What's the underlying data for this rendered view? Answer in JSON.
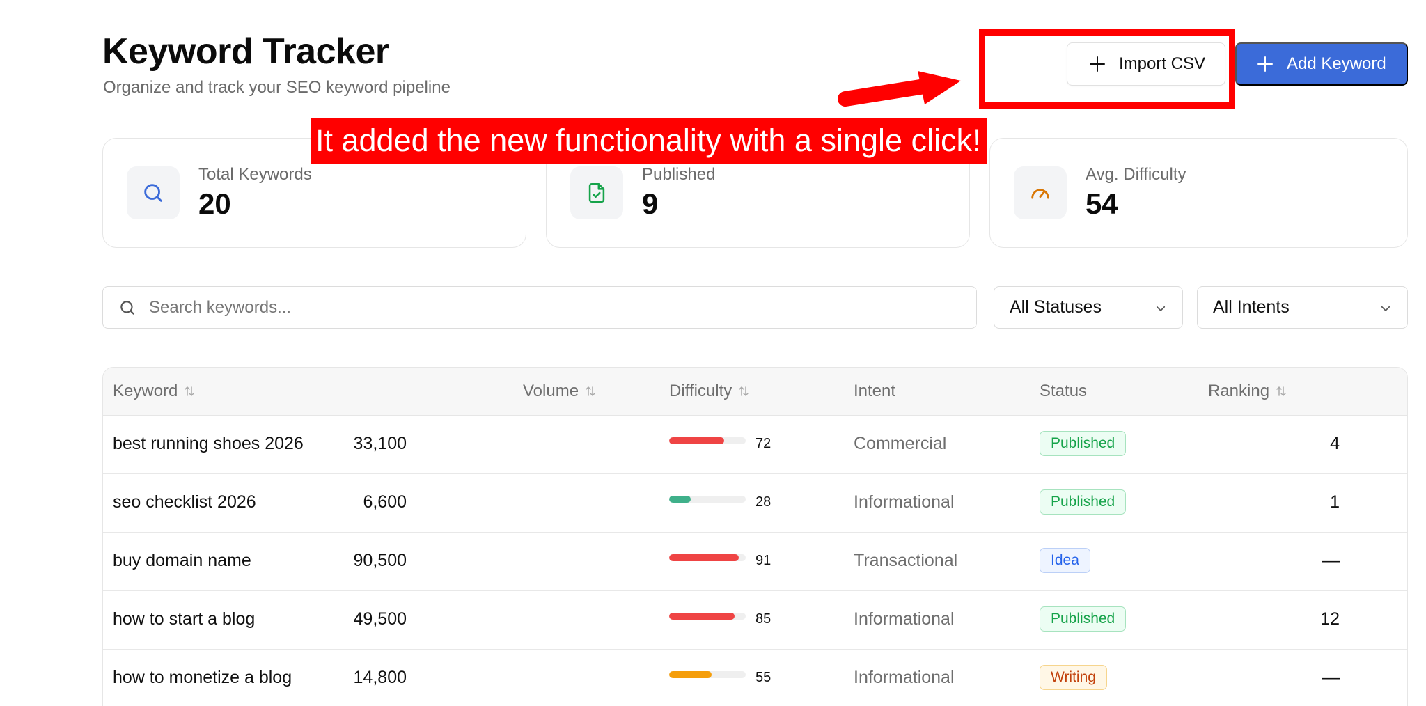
{
  "header": {
    "title": "Keyword Tracker",
    "subtitle": "Organize and track your SEO keyword pipeline",
    "import_label": "Import CSV",
    "add_label": "Add Keyword"
  },
  "annotation": {
    "caption": "It added the new functionality with a single click!",
    "color": "#ff0000"
  },
  "stats": [
    {
      "label": "Total Keywords",
      "value": "20",
      "icon": "search-icon",
      "color": "#3b6bd9"
    },
    {
      "label": "Published",
      "value": "9",
      "icon": "file-check-icon",
      "color": "#16a34a"
    },
    {
      "label": "Avg. Difficulty",
      "value": "54",
      "icon": "gauge-icon",
      "color": "#d97706"
    }
  ],
  "filters": {
    "search_placeholder": "Search keywords...",
    "status_value": "All Statuses",
    "intent_value": "All Intents"
  },
  "table": {
    "columns": {
      "keyword": "Keyword",
      "volume": "Volume",
      "difficulty": "Difficulty",
      "intent": "Intent",
      "status": "Status",
      "ranking": "Ranking"
    },
    "rows": [
      {
        "keyword": "best running shoes 2026",
        "volume": "33,100",
        "difficulty": 72,
        "difficulty_label": "72",
        "intent": "Commercial",
        "status": "Published",
        "ranking": "4"
      },
      {
        "keyword": "seo checklist 2026",
        "volume": "6,600",
        "difficulty": 28,
        "difficulty_label": "28",
        "intent": "Informational",
        "status": "Published",
        "ranking": "1"
      },
      {
        "keyword": "buy domain name",
        "volume": "90,500",
        "difficulty": 91,
        "difficulty_label": "91",
        "intent": "Transactional",
        "status": "Idea",
        "ranking": "—"
      },
      {
        "keyword": "how to start a blog",
        "volume": "49,500",
        "difficulty": 85,
        "difficulty_label": "85",
        "intent": "Informational",
        "status": "Published",
        "ranking": "12"
      },
      {
        "keyword": "how to monetize a blog",
        "volume": "14,800",
        "difficulty": 55,
        "difficulty_label": "55",
        "intent": "Informational",
        "status": "Writing",
        "ranking": "—"
      }
    ]
  },
  "colors": {
    "accent": "#3b6bd9",
    "difficulty_high": "#ef4444",
    "difficulty_medium": "#f59e0b",
    "difficulty_low": "#3fb08a",
    "status_published": "#16a34a",
    "status_idea": "#2563eb",
    "status_writing": "#c2410c"
  }
}
